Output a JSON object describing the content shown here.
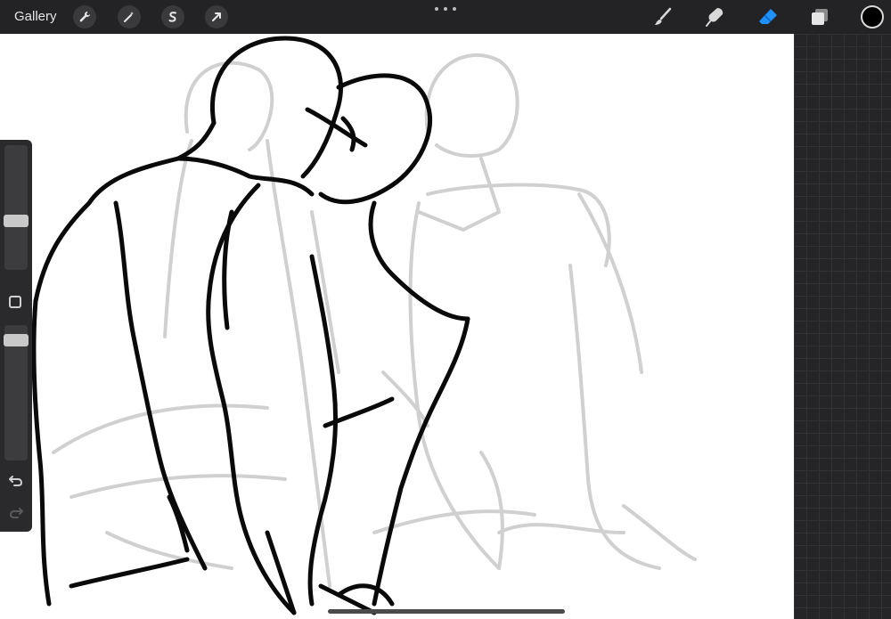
{
  "topbar": {
    "gallery_label": "Gallery",
    "left_tools": [
      {
        "name": "actions",
        "icon": "wrench-icon"
      },
      {
        "name": "adjustments",
        "icon": "magic-wand-icon"
      },
      {
        "name": "selection",
        "icon": "selection-s-icon"
      },
      {
        "name": "transform",
        "icon": "arrow-cursor-icon"
      }
    ],
    "more_icon": "more-dots-icon",
    "right_tools": [
      {
        "name": "brush",
        "icon": "brush-icon",
        "active": false
      },
      {
        "name": "smudge",
        "icon": "smudge-icon",
        "active": false
      },
      {
        "name": "eraser",
        "icon": "eraser-icon",
        "active": true
      },
      {
        "name": "layers",
        "icon": "layers-icon",
        "active": false
      }
    ],
    "current_color": "#000000",
    "active_tool_color": "#1e90ff"
  },
  "sidebar": {
    "brush_size": 0.6,
    "opacity": 1.0,
    "undo_icon": "undo-icon",
    "redo_icon": "redo-icon",
    "modify_icon": "modify-square-icon"
  },
  "canvas": {
    "background": "#ffffff",
    "sketch_ink_color": "#000000",
    "sketch_underlayer_color": "#cfcfcf"
  }
}
